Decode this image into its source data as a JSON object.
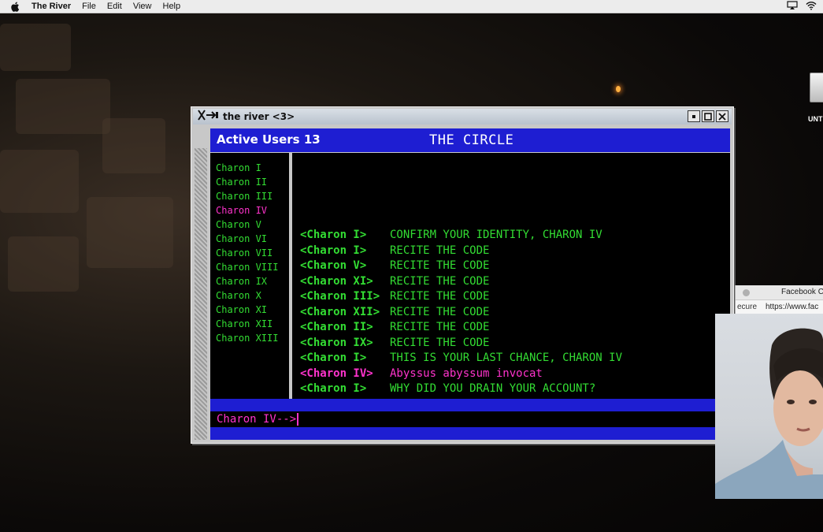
{
  "menubar": {
    "app_name": "The River",
    "items": [
      "File",
      "Edit",
      "View",
      "Help"
    ]
  },
  "desktop": {
    "disk_label": "UNT"
  },
  "chat_window": {
    "title": "the river <3>",
    "header": {
      "active_users": "Active Users 13",
      "room_title": "THE CIRCLE"
    },
    "users": [
      {
        "name": "Charon I",
        "me": false
      },
      {
        "name": "Charon II",
        "me": false
      },
      {
        "name": "Charon III",
        "me": false
      },
      {
        "name": "Charon IV",
        "me": true
      },
      {
        "name": "Charon V",
        "me": false
      },
      {
        "name": "Charon VI",
        "me": false
      },
      {
        "name": "Charon VII",
        "me": false
      },
      {
        "name": "Charon VIII",
        "me": false
      },
      {
        "name": "Charon IX",
        "me": false
      },
      {
        "name": "Charon X",
        "me": false
      },
      {
        "name": "Charon XI",
        "me": false
      },
      {
        "name": "Charon XII",
        "me": false
      },
      {
        "name": "Charon XIII",
        "me": false
      }
    ],
    "messages": [
      {
        "sender": "<Charon I>",
        "text": "CONFIRM YOUR IDENTITY, CHARON IV",
        "me": false
      },
      {
        "sender": "<Charon I>",
        "text": "RECITE THE CODE",
        "me": false
      },
      {
        "sender": "<Charon V>",
        "text": "RECITE THE CODE",
        "me": false
      },
      {
        "sender": "<Charon XI>",
        "text": "RECITE THE CODE",
        "me": false
      },
      {
        "sender": "<Charon III>",
        "text": "RECITE THE CODE",
        "me": false
      },
      {
        "sender": "<Charon XII>",
        "text": "RECITE THE CODE",
        "me": false
      },
      {
        "sender": "<Charon II>",
        "text": "RECITE THE CODE",
        "me": false
      },
      {
        "sender": "<Charon IX>",
        "text": "RECITE THE CODE",
        "me": false
      },
      {
        "sender": "<Charon I>",
        "text": "THIS IS YOUR LAST CHANCE, CHARON IV",
        "me": false
      },
      {
        "sender": "<Charon IV>",
        "text": "Abyssus abyssum invocat",
        "me": true
      },
      {
        "sender": "<Charon I>",
        "text": "WHY DID YOU DRAIN YOUR ACCOUNT?",
        "me": false
      }
    ],
    "input": {
      "prompt": "Charon IV-->"
    }
  },
  "fb_window": {
    "title": "Facebook C",
    "secure": "ecure",
    "url": "https://www.fac"
  },
  "colors": {
    "header_blue": "#1e1ed2",
    "green_text": "#33dd33",
    "magenta_text": "#ff33cc"
  }
}
